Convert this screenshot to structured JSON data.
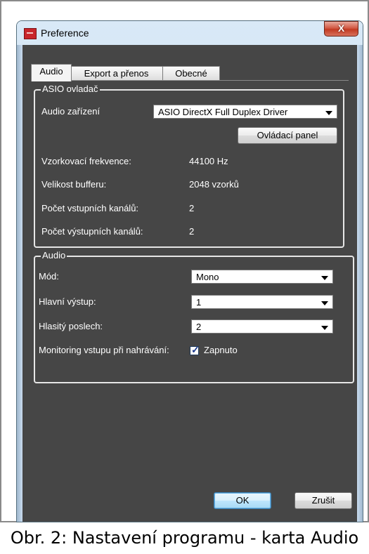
{
  "window": {
    "title": "Preference",
    "close_glyph": "X"
  },
  "tabs": [
    {
      "label": "Audio",
      "active": true
    },
    {
      "label": "Export a přenos",
      "active": false
    },
    {
      "label": "Obecné",
      "active": false
    }
  ],
  "asio": {
    "legend": "ASIO ovladač",
    "device_label": "Audio zařízení",
    "device_value": "ASIO DirectX Full Duplex Driver",
    "panel_button": "Ovládací panel",
    "rows": [
      {
        "label": "Vzorkovací frekvence:",
        "value": "44100 Hz"
      },
      {
        "label": "Velikost bufferu:",
        "value": "2048 vzorků"
      },
      {
        "label": "Počet vstupních kanálů:",
        "value": "2"
      },
      {
        "label": "Počet výstupních kanálů:",
        "value": "2"
      }
    ]
  },
  "audio": {
    "legend": "Audio",
    "mode_label": "Mód:",
    "mode_value": "Mono",
    "main_out_label": "Hlavní výstup:",
    "main_out_value": "1",
    "loud_label": "Hlasitý poslech:",
    "loud_value": "2",
    "monitor_label": "Monitoring vstupu při nahrávání:",
    "monitor_checkbox_label": "Zapnuto",
    "monitor_checked": true
  },
  "buttons": {
    "ok": "OK",
    "cancel": "Zrušit"
  },
  "caption": "Obr. 2: Nastavení programu - karta Audio",
  "colors": {
    "client_bg": "#464646",
    "titlebar": "#c4daef",
    "close": "#c23a22"
  }
}
